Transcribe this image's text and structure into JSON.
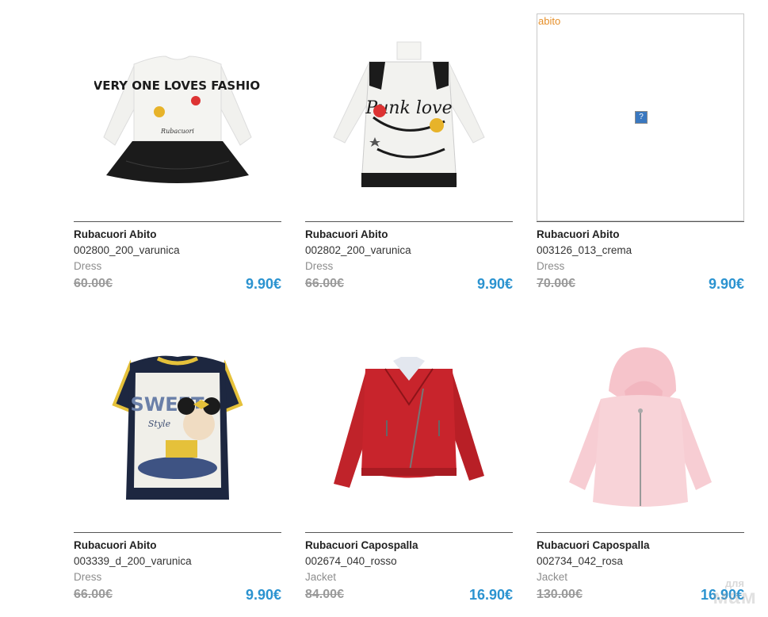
{
  "products": [
    {
      "brand": "Rubacuori Abito",
      "code": "002800_200_varunica",
      "category": "Dress",
      "old_price": "60.00€",
      "new_price": "9.90€",
      "image_alt": "",
      "print_text": "EVERY ONE LOVES FASHION",
      "print_sub": "Rubacuori"
    },
    {
      "brand": "Rubacuori Abito",
      "code": "002802_200_varunica",
      "category": "Dress",
      "old_price": "66.00€",
      "new_price": "9.90€",
      "image_alt": "",
      "print_text": "Punk love",
      "print_sub": ""
    },
    {
      "brand": "Rubacuori Abito",
      "code": "003126_013_crema",
      "category": "Dress",
      "old_price": "70.00€",
      "new_price": "9.90€",
      "image_alt": "abito",
      "broken_icon": "?"
    },
    {
      "brand": "Rubacuori Abito",
      "code": "003339_d_200_varunica",
      "category": "Dress",
      "old_price": "66.00€",
      "new_price": "9.90€",
      "image_alt": "",
      "print_text": "SWEET",
      "print_sub": "Style"
    },
    {
      "brand": "Rubacuori Capospalla",
      "code": "002674_040_rosso",
      "category": "Jacket",
      "old_price": "84.00€",
      "new_price": "16.90€",
      "image_alt": ""
    },
    {
      "brand": "Rubacuori Capospalla",
      "code": "002734_042_rosa",
      "category": "Jacket",
      "old_price": "130.00€",
      "new_price": "16.90€",
      "image_alt": ""
    }
  ],
  "watermark": {
    "top": "для",
    "main": "мам"
  },
  "colors": {
    "price_accent": "#2b93d0",
    "old_price": "#9a9a9a",
    "alt_text": "#e6902b"
  }
}
